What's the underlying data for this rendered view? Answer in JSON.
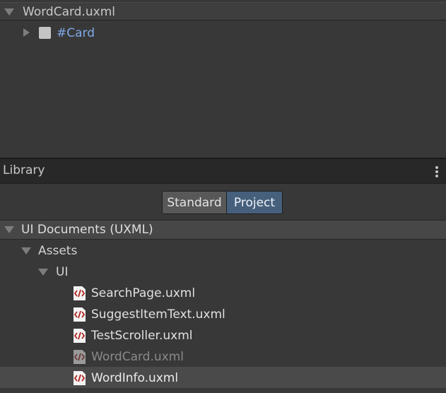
{
  "hierarchy": {
    "document_name": "WordCard.uxml",
    "root_element": "#Card"
  },
  "library": {
    "title": "Library",
    "tabs": {
      "standard": "Standard",
      "project": "Project",
      "selected": "Project"
    },
    "category": "UI Documents (UXML)",
    "folder_assets": "Assets",
    "folder_ui": "UI",
    "files": [
      {
        "name": "SearchPage.uxml",
        "state": "normal",
        "icon": "uxml-file-icon"
      },
      {
        "name": "SuggestItemText.uxml",
        "state": "normal",
        "icon": "uxml-file-icon"
      },
      {
        "name": "TestScroller.uxml",
        "state": "normal",
        "icon": "uxml-file-icon"
      },
      {
        "name": "WordCard.uxml",
        "state": "disabled",
        "icon": "uxml-file-icon"
      },
      {
        "name": "WordInfo.uxml",
        "state": "hovered",
        "icon": "uxml-file-icon"
      }
    ]
  },
  "colors": {
    "panel_bg": "#383838",
    "header_bg": "#282828",
    "selected_tab": "#46607c",
    "element_link": "#7fa8e6",
    "icon_red": "#b0201c"
  }
}
